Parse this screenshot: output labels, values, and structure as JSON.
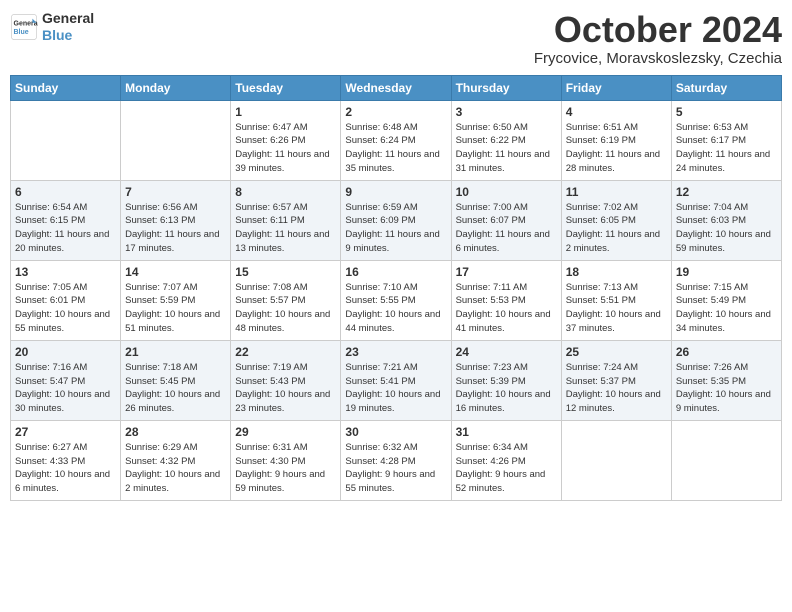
{
  "header": {
    "logo_line1": "General",
    "logo_line2": "Blue",
    "month": "October 2024",
    "location": "Frycovice, Moravskoslezsky, Czechia"
  },
  "days_of_week": [
    "Sunday",
    "Monday",
    "Tuesday",
    "Wednesday",
    "Thursday",
    "Friday",
    "Saturday"
  ],
  "weeks": [
    [
      {
        "day": "",
        "info": ""
      },
      {
        "day": "",
        "info": ""
      },
      {
        "day": "1",
        "info": "Sunrise: 6:47 AM\nSunset: 6:26 PM\nDaylight: 11 hours and 39 minutes."
      },
      {
        "day": "2",
        "info": "Sunrise: 6:48 AM\nSunset: 6:24 PM\nDaylight: 11 hours and 35 minutes."
      },
      {
        "day": "3",
        "info": "Sunrise: 6:50 AM\nSunset: 6:22 PM\nDaylight: 11 hours and 31 minutes."
      },
      {
        "day": "4",
        "info": "Sunrise: 6:51 AM\nSunset: 6:19 PM\nDaylight: 11 hours and 28 minutes."
      },
      {
        "day": "5",
        "info": "Sunrise: 6:53 AM\nSunset: 6:17 PM\nDaylight: 11 hours and 24 minutes."
      }
    ],
    [
      {
        "day": "6",
        "info": "Sunrise: 6:54 AM\nSunset: 6:15 PM\nDaylight: 11 hours and 20 minutes."
      },
      {
        "day": "7",
        "info": "Sunrise: 6:56 AM\nSunset: 6:13 PM\nDaylight: 11 hours and 17 minutes."
      },
      {
        "day": "8",
        "info": "Sunrise: 6:57 AM\nSunset: 6:11 PM\nDaylight: 11 hours and 13 minutes."
      },
      {
        "day": "9",
        "info": "Sunrise: 6:59 AM\nSunset: 6:09 PM\nDaylight: 11 hours and 9 minutes."
      },
      {
        "day": "10",
        "info": "Sunrise: 7:00 AM\nSunset: 6:07 PM\nDaylight: 11 hours and 6 minutes."
      },
      {
        "day": "11",
        "info": "Sunrise: 7:02 AM\nSunset: 6:05 PM\nDaylight: 11 hours and 2 minutes."
      },
      {
        "day": "12",
        "info": "Sunrise: 7:04 AM\nSunset: 6:03 PM\nDaylight: 10 hours and 59 minutes."
      }
    ],
    [
      {
        "day": "13",
        "info": "Sunrise: 7:05 AM\nSunset: 6:01 PM\nDaylight: 10 hours and 55 minutes."
      },
      {
        "day": "14",
        "info": "Sunrise: 7:07 AM\nSunset: 5:59 PM\nDaylight: 10 hours and 51 minutes."
      },
      {
        "day": "15",
        "info": "Sunrise: 7:08 AM\nSunset: 5:57 PM\nDaylight: 10 hours and 48 minutes."
      },
      {
        "day": "16",
        "info": "Sunrise: 7:10 AM\nSunset: 5:55 PM\nDaylight: 10 hours and 44 minutes."
      },
      {
        "day": "17",
        "info": "Sunrise: 7:11 AM\nSunset: 5:53 PM\nDaylight: 10 hours and 41 minutes."
      },
      {
        "day": "18",
        "info": "Sunrise: 7:13 AM\nSunset: 5:51 PM\nDaylight: 10 hours and 37 minutes."
      },
      {
        "day": "19",
        "info": "Sunrise: 7:15 AM\nSunset: 5:49 PM\nDaylight: 10 hours and 34 minutes."
      }
    ],
    [
      {
        "day": "20",
        "info": "Sunrise: 7:16 AM\nSunset: 5:47 PM\nDaylight: 10 hours and 30 minutes."
      },
      {
        "day": "21",
        "info": "Sunrise: 7:18 AM\nSunset: 5:45 PM\nDaylight: 10 hours and 26 minutes."
      },
      {
        "day": "22",
        "info": "Sunrise: 7:19 AM\nSunset: 5:43 PM\nDaylight: 10 hours and 23 minutes."
      },
      {
        "day": "23",
        "info": "Sunrise: 7:21 AM\nSunset: 5:41 PM\nDaylight: 10 hours and 19 minutes."
      },
      {
        "day": "24",
        "info": "Sunrise: 7:23 AM\nSunset: 5:39 PM\nDaylight: 10 hours and 16 minutes."
      },
      {
        "day": "25",
        "info": "Sunrise: 7:24 AM\nSunset: 5:37 PM\nDaylight: 10 hours and 12 minutes."
      },
      {
        "day": "26",
        "info": "Sunrise: 7:26 AM\nSunset: 5:35 PM\nDaylight: 10 hours and 9 minutes."
      }
    ],
    [
      {
        "day": "27",
        "info": "Sunrise: 6:27 AM\nSunset: 4:33 PM\nDaylight: 10 hours and 6 minutes."
      },
      {
        "day": "28",
        "info": "Sunrise: 6:29 AM\nSunset: 4:32 PM\nDaylight: 10 hours and 2 minutes."
      },
      {
        "day": "29",
        "info": "Sunrise: 6:31 AM\nSunset: 4:30 PM\nDaylight: 9 hours and 59 minutes."
      },
      {
        "day": "30",
        "info": "Sunrise: 6:32 AM\nSunset: 4:28 PM\nDaylight: 9 hours and 55 minutes."
      },
      {
        "day": "31",
        "info": "Sunrise: 6:34 AM\nSunset: 4:26 PM\nDaylight: 9 hours and 52 minutes."
      },
      {
        "day": "",
        "info": ""
      },
      {
        "day": "",
        "info": ""
      }
    ]
  ]
}
